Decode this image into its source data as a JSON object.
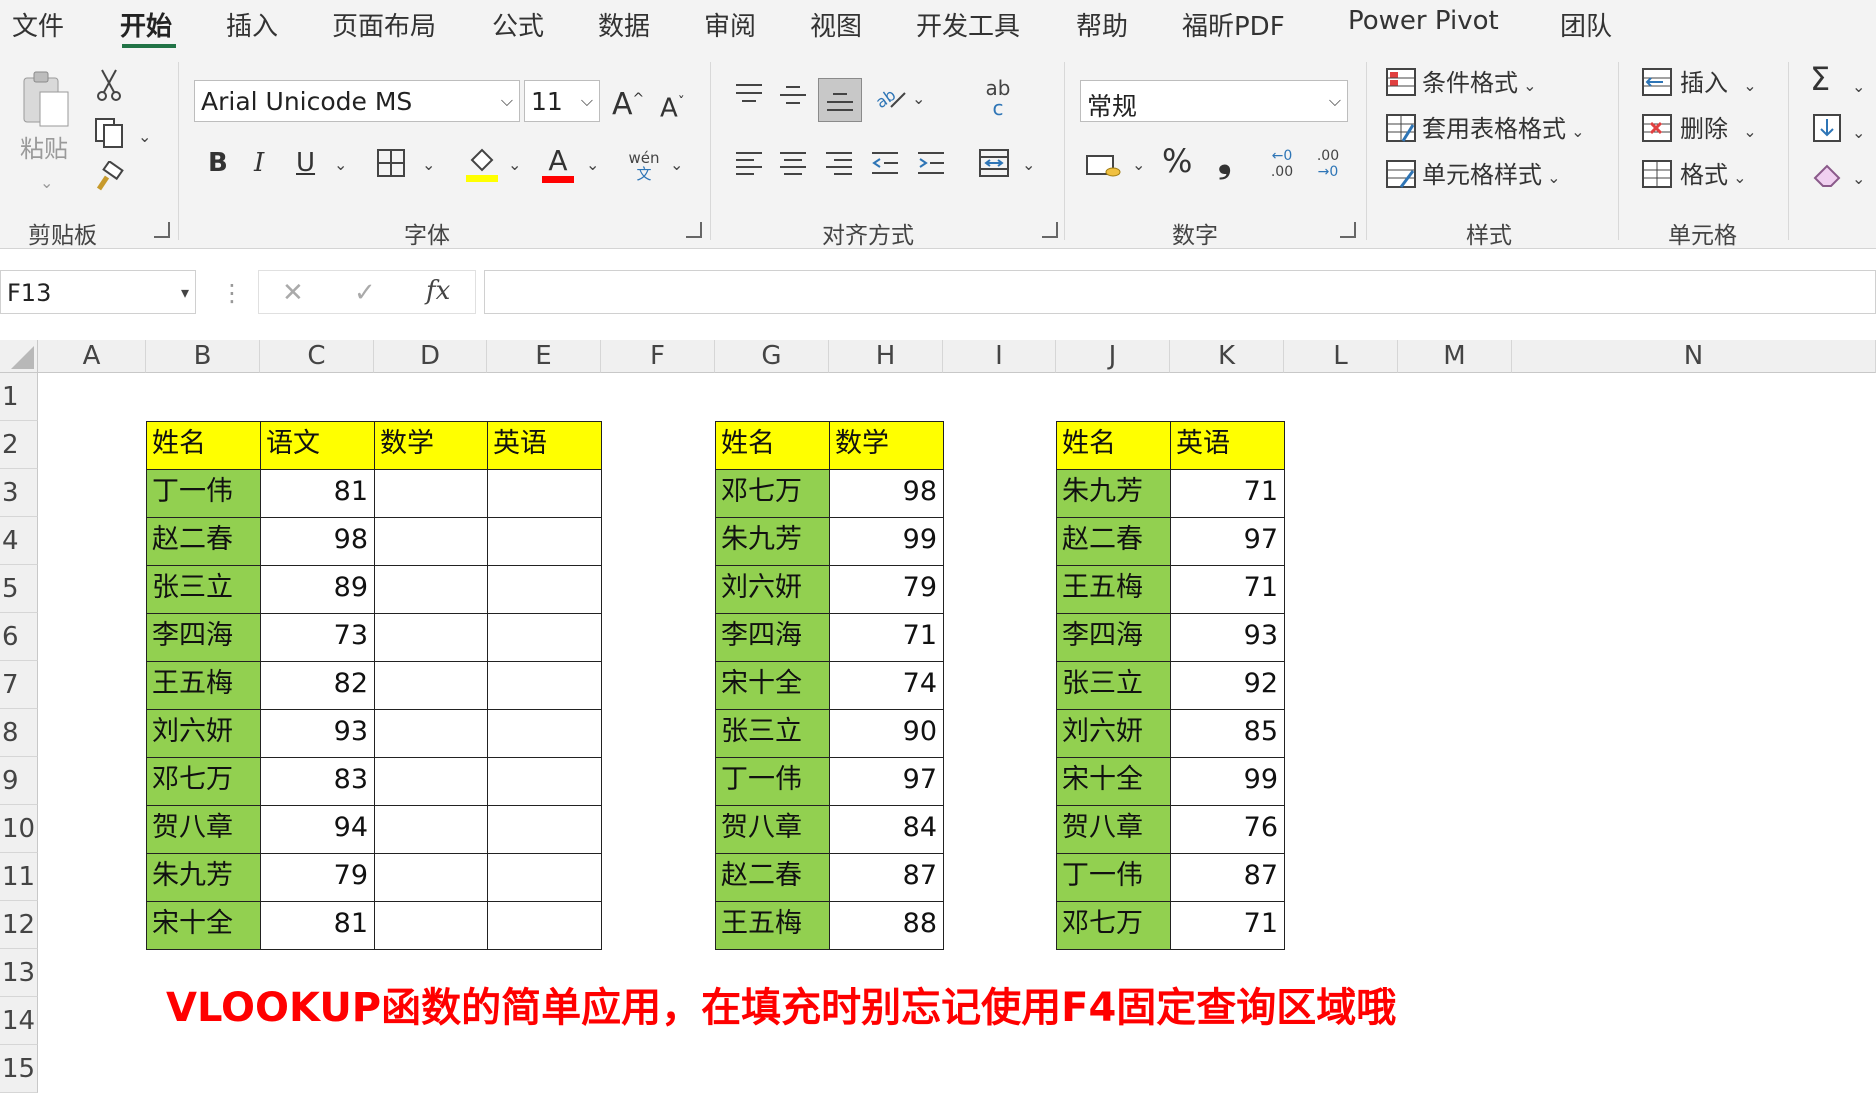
{
  "ribbon_tabs": [
    "文件",
    "开始",
    "插入",
    "页面布局",
    "公式",
    "数据",
    "审阅",
    "视图",
    "开发工具",
    "帮助",
    "福昕PDF",
    "Power Pivot",
    "团队"
  ],
  "active_tab": "开始",
  "clipboard": {
    "paste_label": "粘贴",
    "group_label": "剪贴板"
  },
  "font": {
    "name": "Arial Unicode MS",
    "size": "11",
    "group_label": "字体",
    "bold": "B",
    "italic": "I",
    "underline": "U",
    "phonetic_top": "wén",
    "phonetic_bottom": "文",
    "grow": "A",
    "shrink": "A",
    "font_color_letter": "A"
  },
  "alignment": {
    "group_label": "对齐方式",
    "wrap_top": "ab",
    "wrap_bottom": "c"
  },
  "number": {
    "format": "常规",
    "group_label": "数字",
    "percent": "%",
    "comma": "❟",
    "inc_decimal": ".00",
    "dec_decimal": ".00"
  },
  "styles": {
    "conditional": "条件格式",
    "table_format": "套用表格格式",
    "cell_styles": "单元格样式",
    "group_label": "样式"
  },
  "cells": {
    "insert": "插入",
    "delete": "删除",
    "format": "格式",
    "group_label": "单元格"
  },
  "formula_bar": {
    "name_box": "F13",
    "cancel": "✕",
    "enter": "✓",
    "fx": "fx",
    "content": ""
  },
  "columns": [
    "A",
    "B",
    "C",
    "D",
    "E",
    "F",
    "G",
    "H",
    "I",
    "J",
    "K",
    "L",
    "M",
    "N"
  ],
  "rows": [
    "1",
    "2",
    "3",
    "4",
    "5",
    "6",
    "7",
    "8",
    "9",
    "10",
    "11",
    "12",
    "13",
    "14",
    "15"
  ],
  "table1": {
    "headers": [
      "姓名",
      "语文",
      "数学",
      "英语"
    ],
    "rows": [
      [
        "丁一伟",
        "81",
        "",
        ""
      ],
      [
        "赵二春",
        "98",
        "",
        ""
      ],
      [
        "张三立",
        "89",
        "",
        ""
      ],
      [
        "李四海",
        "73",
        "",
        ""
      ],
      [
        "王五梅",
        "82",
        "",
        ""
      ],
      [
        "刘六妍",
        "93",
        "",
        ""
      ],
      [
        "邓七万",
        "83",
        "",
        ""
      ],
      [
        "贺八章",
        "94",
        "",
        ""
      ],
      [
        "朱九芳",
        "79",
        "",
        ""
      ],
      [
        "宋十全",
        "81",
        "",
        ""
      ]
    ]
  },
  "table2": {
    "headers": [
      "姓名",
      "数学"
    ],
    "rows": [
      [
        "邓七万",
        "98"
      ],
      [
        "朱九芳",
        "99"
      ],
      [
        "刘六妍",
        "79"
      ],
      [
        "李四海",
        "71"
      ],
      [
        "宋十全",
        "74"
      ],
      [
        "张三立",
        "90"
      ],
      [
        "丁一伟",
        "97"
      ],
      [
        "贺八章",
        "84"
      ],
      [
        "赵二春",
        "87"
      ],
      [
        "王五梅",
        "88"
      ]
    ]
  },
  "table3": {
    "headers": [
      "姓名",
      "英语"
    ],
    "rows": [
      [
        "朱九芳",
        "71"
      ],
      [
        "赵二春",
        "97"
      ],
      [
        "王五梅",
        "71"
      ],
      [
        "李四海",
        "93"
      ],
      [
        "张三立",
        "92"
      ],
      [
        "刘六妍",
        "85"
      ],
      [
        "宋十全",
        "99"
      ],
      [
        "贺八章",
        "76"
      ],
      [
        "丁一伟",
        "87"
      ],
      [
        "邓七万",
        "71"
      ]
    ]
  },
  "note": "VLOOKUP函数的简单应用，在填充时别忘记使用F4固定查询区域哦",
  "colors": {
    "header_fill": "#ffff00",
    "name_fill": "#92d050",
    "note": "#ff0000",
    "accent": "#217346"
  }
}
